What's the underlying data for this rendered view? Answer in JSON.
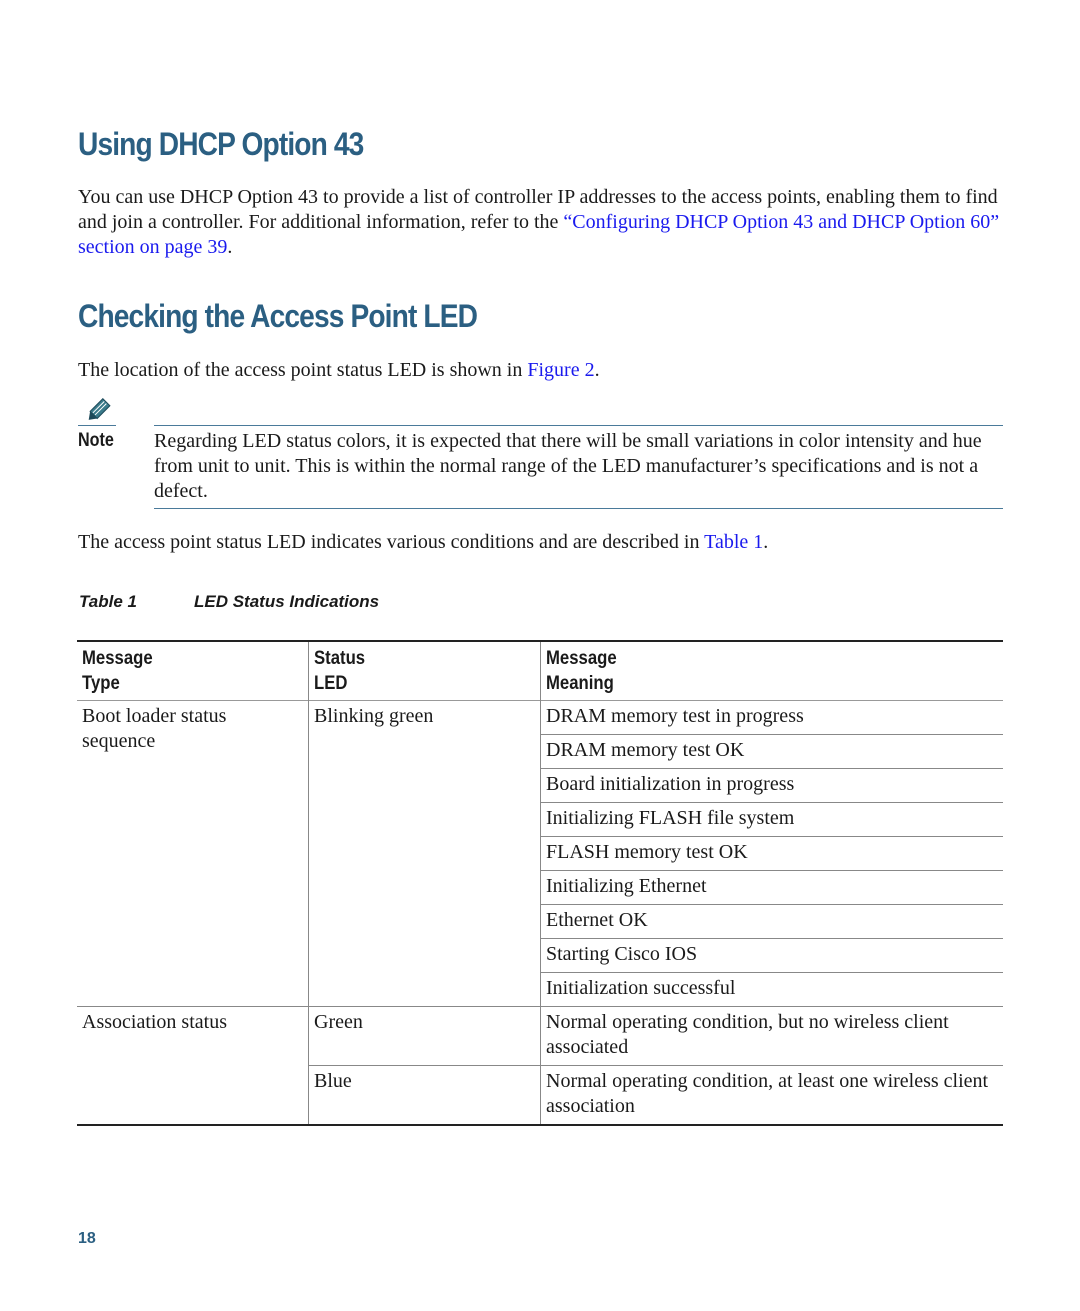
{
  "section1": {
    "heading": "Using DHCP Option 43",
    "text_before": "You can use DHCP Option 43 to provide a list of controller IP addresses to the access points, enabling them to find and join a controller. For additional information, refer to the ",
    "link": "“Configuring DHCP Option 43 and DHCP Option 60” section on page 39",
    "text_after": "."
  },
  "section2": {
    "heading": "Checking the Access Point LED",
    "intro_before": "The location of the access point status LED is shown in ",
    "intro_link": "Figure 2",
    "intro_after": ".",
    "note_label": "Note",
    "note_text": "Regarding LED status colors, it is expected that there will be small variations in color intensity and hue from unit to unit. This is within the normal range of the LED manufacturer’s specifications and is not a defect.",
    "table_intro_before": "The access point status LED indicates various conditions and are described in ",
    "table_intro_link": "Table 1",
    "table_intro_after": "."
  },
  "table": {
    "caption_number": "Table 1",
    "caption_title": "LED Status Indications",
    "headers": [
      "Message Type",
      "Status LED",
      "Message Meaning"
    ],
    "header_lines": [
      [
        "Message",
        "Type"
      ],
      [
        "Status",
        "LED"
      ],
      [
        "Message",
        "Meaning"
      ]
    ],
    "groups": [
      {
        "type": "Boot loader status sequence",
        "status": "Blinking green",
        "meanings": [
          "DRAM memory test in progress",
          "DRAM memory test OK",
          "Board initialization in progress",
          "Initializing FLASH file system",
          "FLASH memory test OK",
          "Initializing Ethernet",
          "Ethernet OK",
          "Starting Cisco IOS",
          "Initialization successful"
        ]
      },
      {
        "type": "Association status",
        "rows": [
          {
            "status": "Green",
            "meaning": "Normal operating condition, but no wireless client associated"
          },
          {
            "status": "Blue",
            "meaning": "Normal operating condition, at least one wireless client association"
          }
        ]
      }
    ]
  },
  "footer": {
    "page_number": "18"
  }
}
